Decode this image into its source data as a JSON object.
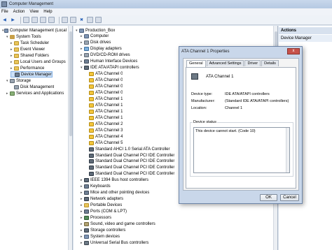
{
  "window": {
    "title": "Computer Management"
  },
  "menu": [
    "File",
    "Action",
    "View",
    "Help"
  ],
  "left_tree": [
    {
      "label": "Computer Management (Local",
      "icon": "computer-icon",
      "level": 0,
      "arrow": "▾"
    },
    {
      "label": "System Tools",
      "icon": "tools-icon",
      "level": 1,
      "arrow": "▾"
    },
    {
      "label": "Task Scheduler",
      "icon": "folder-icon",
      "level": 2,
      "arrow": "▸"
    },
    {
      "label": "Event Viewer",
      "icon": "folder-icon",
      "level": 2,
      "arrow": "▸"
    },
    {
      "label": "Shared Folders",
      "icon": "folder-icon",
      "level": 2,
      "arrow": "▸"
    },
    {
      "label": "Local Users and Groups",
      "icon": "folder-icon",
      "level": 2,
      "arrow": "▸"
    },
    {
      "label": "Performance",
      "icon": "folder-icon",
      "level": 2,
      "arrow": "▸"
    },
    {
      "label": "Device Manager",
      "icon": "device-icon",
      "level": 2,
      "arrow": "",
      "selected": true
    },
    {
      "label": "Storage",
      "icon": "disk-icon",
      "level": 1,
      "arrow": "▾"
    },
    {
      "label": "Disk Management",
      "icon": "disk-icon",
      "level": 2,
      "arrow": ""
    },
    {
      "label": "Services and Applications",
      "icon": "services-icon",
      "level": 1,
      "arrow": "▸"
    }
  ],
  "center_tree": [
    {
      "label": "Production_Box",
      "icon": "computer-icon",
      "level": 0,
      "arrow": "▾"
    },
    {
      "label": "Computer",
      "icon": "computer-icon",
      "level": 1,
      "arrow": "▸"
    },
    {
      "label": "Disk drives",
      "icon": "disk-icon",
      "level": 1,
      "arrow": "▸"
    },
    {
      "label": "Display adapters",
      "icon": "monitor-icon",
      "level": 1,
      "arrow": "▸"
    },
    {
      "label": "DVD/CD-ROM drives",
      "icon": "disk-icon",
      "level": 1,
      "arrow": "▸"
    },
    {
      "label": "Human Interface Devices",
      "icon": "device-icon",
      "level": 1,
      "arrow": "▸"
    },
    {
      "label": "IDE ATA/ATAPI controllers",
      "icon": "chip-icon",
      "level": 1,
      "arrow": "▾"
    },
    {
      "label": "ATA Channel 0",
      "icon": "warning-icon",
      "level": 2,
      "arrow": ""
    },
    {
      "label": "ATA Channel 0",
      "icon": "warning-icon",
      "level": 2,
      "arrow": ""
    },
    {
      "label": "ATA Channel 0",
      "icon": "warning-icon",
      "level": 2,
      "arrow": ""
    },
    {
      "label": "ATA Channel 0",
      "icon": "warning-icon",
      "level": 2,
      "arrow": ""
    },
    {
      "label": "ATA Channel 1",
      "icon": "warning-icon",
      "level": 2,
      "arrow": ""
    },
    {
      "label": "ATA Channel 1",
      "icon": "warning-icon",
      "level": 2,
      "arrow": ""
    },
    {
      "label": "ATA Channel 1",
      "icon": "warning-icon",
      "level": 2,
      "arrow": ""
    },
    {
      "label": "ATA Channel 1",
      "icon": "warning-icon",
      "level": 2,
      "arrow": ""
    },
    {
      "label": "ATA Channel 2",
      "icon": "warning-icon",
      "level": 2,
      "arrow": ""
    },
    {
      "label": "ATA Channel 3",
      "icon": "warning-icon",
      "level": 2,
      "arrow": ""
    },
    {
      "label": "ATA Channel 4",
      "icon": "warning-icon",
      "level": 2,
      "arrow": ""
    },
    {
      "label": "ATA Channel 5",
      "icon": "warning-icon",
      "level": 2,
      "arrow": ""
    },
    {
      "label": "Standard AHCI 1.0 Serial ATA Controller",
      "icon": "chip-icon",
      "level": 2,
      "arrow": ""
    },
    {
      "label": "Standard Dual Channel PCI IDE Controller",
      "icon": "chip-icon",
      "level": 2,
      "arrow": ""
    },
    {
      "label": "Standard Dual Channel PCI IDE Controller",
      "icon": "chip-icon",
      "level": 2,
      "arrow": ""
    },
    {
      "label": "Standard Dual Channel PCI IDE Controller",
      "icon": "chip-icon",
      "level": 2,
      "arrow": ""
    },
    {
      "label": "Standard Dual Channel PCI IDE Controller",
      "icon": "chip-icon",
      "level": 2,
      "arrow": ""
    },
    {
      "label": "IEEE 1394 Bus host controllers",
      "icon": "chip-icon",
      "level": 1,
      "arrow": "▸"
    },
    {
      "label": "Keyboards",
      "icon": "device-icon",
      "level": 1,
      "arrow": "▸"
    },
    {
      "label": "Mice and other pointing devices",
      "icon": "device-icon",
      "level": 1,
      "arrow": "▸"
    },
    {
      "label": "Network adapters",
      "icon": "chip-icon",
      "level": 1,
      "arrow": "▸"
    },
    {
      "label": "Portable Devices",
      "icon": "folder-icon",
      "level": 1,
      "arrow": "▸"
    },
    {
      "label": "Ports (COM & LPT)",
      "icon": "device-icon",
      "level": 1,
      "arrow": "▸"
    },
    {
      "label": "Processors",
      "icon": "processor-icon",
      "level": 1,
      "arrow": "▸"
    },
    {
      "label": "Sound, video and game controllers",
      "icon": "sound-icon",
      "level": 1,
      "arrow": "▸"
    },
    {
      "label": "Storage controllers",
      "icon": "chip-icon",
      "level": 1,
      "arrow": "▸"
    },
    {
      "label": "System devices",
      "icon": "computer-icon",
      "level": 1,
      "arrow": "▸"
    },
    {
      "label": "Universal Serial Bus controllers",
      "icon": "usb-icon",
      "level": 1,
      "arrow": "▸"
    }
  ],
  "actions": {
    "header": "Actions",
    "item": "Device Manager"
  },
  "dialog": {
    "title": "ATA Channel 1 Properties",
    "close_label": "x",
    "tabs": [
      "General",
      "Advanced Settings",
      "Driver",
      "Details"
    ],
    "device_name": "ATA Channel 1",
    "properties": [
      {
        "label": "Device type:",
        "value": "IDE ATA/ATAPI controllers"
      },
      {
        "label": "Manufacturer:",
        "value": "(Standard IDE ATA/ATAPI controllers)"
      },
      {
        "label": "Location:",
        "value": "Channel 1"
      }
    ],
    "status_title": "Device status",
    "status_text": "This device cannot start. (Code 10)",
    "ok_label": "OK",
    "cancel_label": "Cancel"
  }
}
